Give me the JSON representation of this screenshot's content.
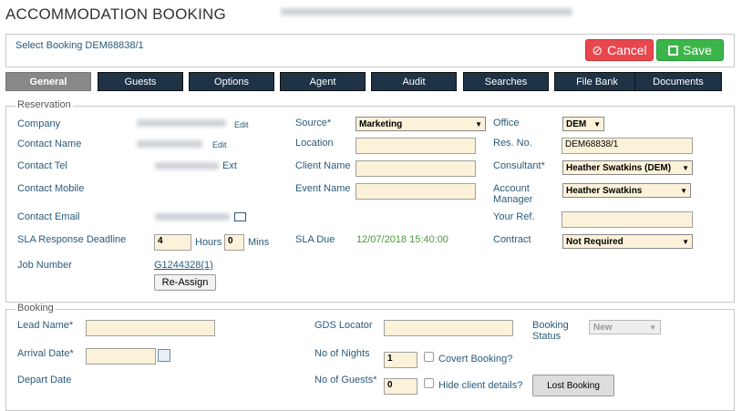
{
  "header": {
    "title": "ACCOMMODATION BOOKING"
  },
  "topbar": {
    "select_booking": "Select Booking DEM68838/1",
    "cancel_label": "Cancel",
    "save_label": "Save"
  },
  "tabs": [
    {
      "label": "General",
      "active": true
    },
    {
      "label": "Guests"
    },
    {
      "label": "Options"
    },
    {
      "label": "Agent"
    },
    {
      "label": "Audit"
    },
    {
      "label": "Searches"
    },
    {
      "label": "File Bank"
    },
    {
      "label": "Documents"
    }
  ],
  "reservation": {
    "legend": "Reservation",
    "company_label": "Company",
    "edit": "Edit",
    "contact_name_label": "Contact Name",
    "contact_tel_label": "Contact Tel",
    "ext": "Ext",
    "contact_mobile_label": "Contact Mobile",
    "contact_email_label": "Contact Email",
    "sla_label": "SLA Response Deadline",
    "sla_hours": "4",
    "hours": "Hours",
    "sla_mins": "0",
    "mins": "Mins",
    "job_label": "Job Number",
    "job_number": "G1244328(1)",
    "reassign": "Re-Assign",
    "source_label": "Source*",
    "source": "Marketing",
    "location_label": "Location",
    "client_name_label": "Client Name",
    "event_name_label": "Event Name",
    "sla_due_label": "SLA Due",
    "sla_due": "12/07/2018 15:40:00",
    "office_label": "Office",
    "office": "DEM",
    "res_no_label": "Res. No.",
    "res_no": "DEM68838/1",
    "consultant_label": "Consultant*",
    "consultant": "Heather Swatkins (DEM)",
    "account_manager_label": "Account Manager",
    "account_manager": "Heather Swatkins",
    "your_ref_label": "Your Ref.",
    "contract_label": "Contract",
    "contract": "Not Required"
  },
  "booking": {
    "legend": "Booking",
    "lead_name_label": "Lead Name*",
    "arrival_label": "Arrival Date*",
    "depart_label": "Depart Date",
    "gds_label": "GDS Locator",
    "nights_label": "No of Nights",
    "nights": "1",
    "covert_label": "Covert Booking?",
    "guests_label": "No of Guests*",
    "guests": "0",
    "hide_label": "Hide client details?",
    "status_label": "Booking Status",
    "status": "New",
    "lost_booking": "Lost Booking"
  }
}
